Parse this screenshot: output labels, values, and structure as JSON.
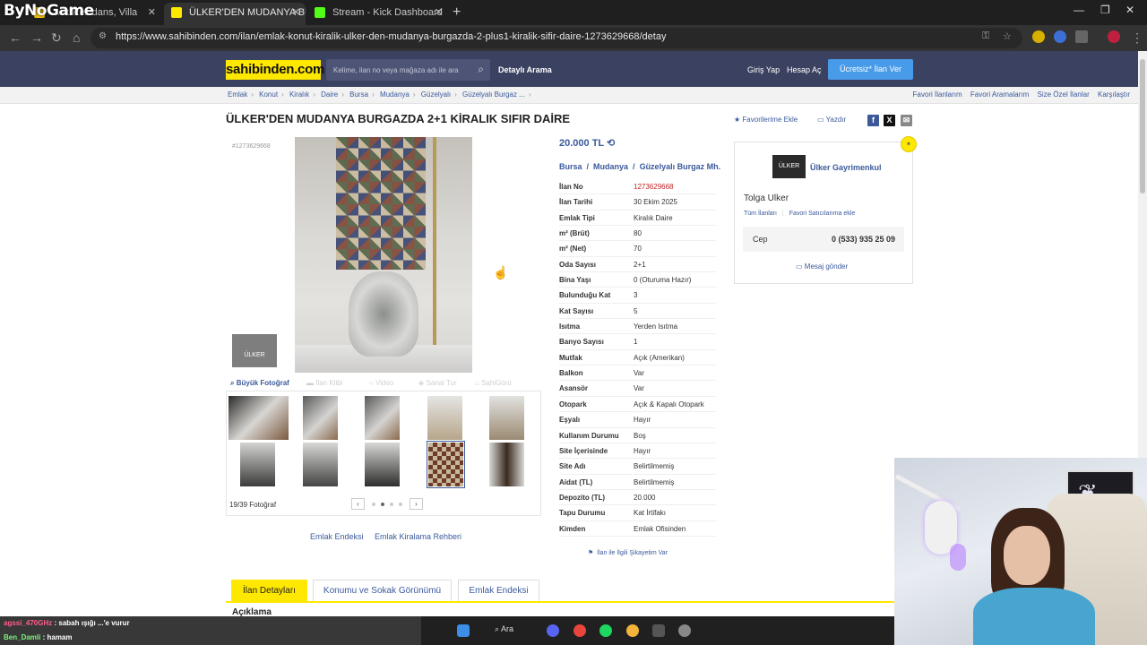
{
  "overlay": {
    "brand": "ByNoGame"
  },
  "browser": {
    "tabs": [
      {
        "label": "...lik Rezidans, Villa",
        "active": false
      },
      {
        "label": "ÜLKER'DEN MUDANYA BURGAZ",
        "active": true
      },
      {
        "label": "Stream - Kick Dashboard",
        "active": false
      }
    ],
    "url": "https://www.sahibinden.com/ilan/emlak-konut-kiralik-ulker-den-mudanya-burgazda-2-plus1-kiralik-sifir-daire-1273629668/detay"
  },
  "header": {
    "logo": "sahibinden.com",
    "search_placeholder": "Kelime, ilan no veya mağaza adı ile ara",
    "detailed_search": "Detaylı Arama",
    "login": "Giriş Yap",
    "register": "Hesap Aç",
    "post_ad": "Ücretsiz* İlan Ver"
  },
  "breadcrumb": [
    "Emlak",
    "Konut",
    "Kiralık",
    "Daire",
    "Bursa",
    "Mudanya",
    "Güzelyalı",
    "Güzelyalı Burgaz ..."
  ],
  "top_right_links": [
    "Favori İlanlarım",
    "Favori Aramalarım",
    "Size Özel İlanlar",
    "Karşılaştır"
  ],
  "listing": {
    "title": "ÜLKER'DEN MUDANYA BURGAZDA 2+1 KİRALIK SIFIR DAİRE",
    "fav_label": "Favorilerime Ekle",
    "print_label": "Yazdır",
    "ad_no_small": "#1273629668",
    "price": "20.000 TL",
    "location": [
      "Bursa",
      "Mudanya",
      "Güzelyalı Burgaz Mh."
    ],
    "details": [
      {
        "k": "İlan No",
        "v": "1273629668",
        "red": true
      },
      {
        "k": "İlan Tarihi",
        "v": "30 Ekim 2025"
      },
      {
        "k": "Emlak Tipi",
        "v": "Kiralık Daire"
      },
      {
        "k": "m² (Brüt)",
        "v": "80"
      },
      {
        "k": "m² (Net)",
        "v": "70"
      },
      {
        "k": "Oda Sayısı",
        "v": "2+1"
      },
      {
        "k": "Bina Yaşı",
        "v": "0 (Oturuma Hazır)"
      },
      {
        "k": "Bulunduğu Kat",
        "v": "3"
      },
      {
        "k": "Kat Sayısı",
        "v": "5"
      },
      {
        "k": "Isıtma",
        "v": "Yerden Isıtma"
      },
      {
        "k": "Banyo Sayısı",
        "v": "1"
      },
      {
        "k": "Mutfak",
        "v": "Açık (Amerikan)"
      },
      {
        "k": "Balkon",
        "v": "Var"
      },
      {
        "k": "Asansör",
        "v": "Var"
      },
      {
        "k": "Otopark",
        "v": "Açık & Kapalı Otopark"
      },
      {
        "k": "Eşyalı",
        "v": "Hayır"
      },
      {
        "k": "Kullanım Durumu",
        "v": "Boş"
      },
      {
        "k": "Site İçerisinde",
        "v": "Hayır"
      },
      {
        "k": "Site Adı",
        "v": "Belirtilmemiş"
      },
      {
        "k": "Aidat (TL)",
        "v": "Belirtilmemiş"
      },
      {
        "k": "Depozito (TL)",
        "v": "20.000"
      },
      {
        "k": "Tapu Durumu",
        "v": "Kat İrtifakı"
      },
      {
        "k": "Kimden",
        "v": "Emlak Ofisinden"
      }
    ],
    "complaint": "İlan ile İlgili Şikayetim Var"
  },
  "gallery": {
    "tabs": [
      "Büyük Fotoğraf",
      "İlan Klibi",
      "Video",
      "Sanal Tur",
      "SahiGörü"
    ],
    "count": "19/39 Fotoğraf",
    "side_logo": "ÜLKER",
    "selected_page": 2,
    "pages": 4
  },
  "mid_links": [
    "Emlak Endeksi",
    "Emlak Kiralama Rehberi"
  ],
  "seller": {
    "company": "Ülker Gayrimenkul",
    "logo_text": "ÜLKER",
    "person": "Tolga Ulker",
    "all_ads": "Tüm İlanları",
    "fav_seller": "Favori Satıcılarıma ekle",
    "phone_label": "Cep",
    "phone": "0 (533) 935 25 09",
    "message": "Mesaj gönder"
  },
  "bottom_tabs": [
    "İlan Detayları",
    "Konumu ve Sokak Görünümü",
    "Emlak Endeksi"
  ],
  "section_title": "Açıklama",
  "chat": [
    {
      "user": "agssi_470GHz",
      "text": ": sabah ışığı ...'e vurur"
    },
    {
      "user": "Ben_Damli",
      "text": ": hamam"
    }
  ],
  "taskbar": {
    "search": "Ara"
  },
  "colors": {
    "header_bg": "#3b4160",
    "logo_yellow": "#ffe800",
    "accent_blue": "#3a5a9c",
    "cta_blue": "#489be8"
  }
}
